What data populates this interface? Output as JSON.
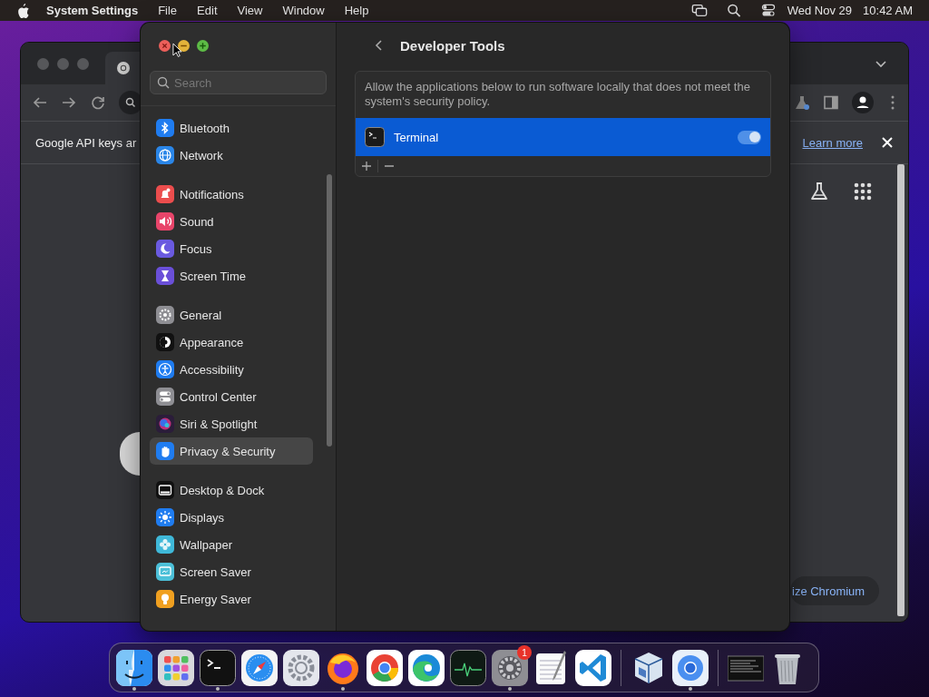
{
  "menu_bar": {
    "app_name": "System Settings",
    "menus": [
      "File",
      "Edit",
      "View",
      "Window",
      "Help"
    ],
    "date": "Wed Nov 29",
    "time": "10:42 AM"
  },
  "browser": {
    "info_text": "Google API keys ar",
    "link": "Learn more",
    "button": "ize Chromium"
  },
  "settings": {
    "search": {
      "placeholder": "Search"
    },
    "sidebar_groups": [
      [
        {
          "label": "Bluetooth",
          "selected": false,
          "color": "#1f7cf0"
        },
        {
          "label": "Network",
          "selected": false,
          "color": "#2a86e8"
        }
      ],
      [
        {
          "label": "Notifications",
          "selected": false,
          "color": "#eb4d4d"
        },
        {
          "label": "Sound",
          "selected": false,
          "color": "#e8456a"
        },
        {
          "label": "Focus",
          "selected": false,
          "color": "#6a5ae0"
        },
        {
          "label": "Screen Time",
          "selected": false,
          "color": "#6a4fd8"
        }
      ],
      [
        {
          "label": "General",
          "selected": false,
          "color": "#8e8e93"
        },
        {
          "label": "Appearance",
          "selected": false,
          "color": "#111111"
        },
        {
          "label": "Accessibility",
          "selected": false,
          "color": "#1f7cf0"
        },
        {
          "label": "Control Center",
          "selected": false,
          "color": "#8e8e93"
        },
        {
          "label": "Siri & Spotlight",
          "selected": false,
          "color": "#2b1d3a"
        },
        {
          "label": "Privacy & Security",
          "selected": true,
          "color": "#1f7cf0"
        }
      ],
      [
        {
          "label": "Desktop & Dock",
          "selected": false,
          "color": "#111111"
        },
        {
          "label": "Displays",
          "selected": false,
          "color": "#1f7cf0"
        },
        {
          "label": "Wallpaper",
          "selected": false,
          "color": "#3fb8d8"
        },
        {
          "label": "Screen Saver",
          "selected": false,
          "color": "#4cc0d8"
        },
        {
          "label": "Energy Saver",
          "selected": false,
          "color": "#f0a020"
        }
      ]
    ],
    "page_title": "Developer Tools",
    "description": "Allow the applications below to run software locally that does not meet the system's security policy.",
    "apps": [
      {
        "name": "Terminal",
        "selected": true,
        "on": true
      }
    ]
  },
  "dock": {
    "groups": [
      [
        {
          "running": true
        },
        {
          "running": false
        },
        {
          "running": true
        },
        {
          "running": false
        },
        {
          "running": false
        },
        {
          "running": true
        },
        {
          "running": false
        },
        {
          "running": false
        },
        {
          "running": false
        },
        {
          "running": true,
          "badge": "1"
        },
        {
          "running": false
        },
        {
          "running": false
        }
      ],
      [
        {
          "running": false
        },
        {
          "running": true
        }
      ],
      [
        {
          "running": false
        },
        {
          "running": false
        }
      ]
    ]
  }
}
